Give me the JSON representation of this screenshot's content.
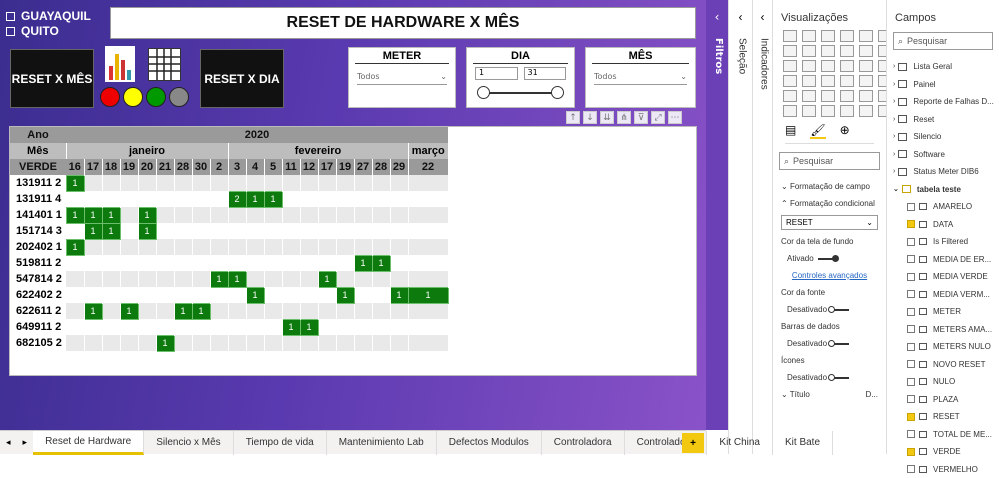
{
  "filters": {
    "guayaquil": "GUAYAQUIL",
    "quito": "QUITO"
  },
  "title": "RESET DE HARDWARE X MÊS",
  "buttons": {
    "reset_mes": "RESET X MÊS",
    "reset_dia": "RESET X DIA"
  },
  "slicers": {
    "meter": {
      "label": "METER",
      "value": "Todos"
    },
    "dia": {
      "label": "DIA",
      "from": "1",
      "to": "31"
    },
    "mes": {
      "label": "MÊS",
      "value": "Todos"
    }
  },
  "matrix": {
    "ano_label": "Ano",
    "year": "2020",
    "mes_label": "Mês",
    "verde_label": "VERDE",
    "months": [
      {
        "name": "janeiro",
        "span": 9
      },
      {
        "name": "fevereiro",
        "span": 12
      },
      {
        "name": "março",
        "span": 1
      }
    ],
    "days": [
      "16",
      "17",
      "18",
      "19",
      "20",
      "21",
      "28",
      "30",
      "2",
      "3",
      "4",
      "5",
      "11",
      "12",
      "17",
      "19",
      "27",
      "28",
      "29",
      "22"
    ],
    "rows": [
      {
        "label": "131911 2",
        "cells": {
          "0": "1"
        }
      },
      {
        "label": "131911 4",
        "cells": {
          "9": "2",
          "10": "1",
          "11": "1"
        }
      },
      {
        "label": "141401 1",
        "cells": {
          "0": "1",
          "1": "1",
          "2": "1",
          "4": "1"
        }
      },
      {
        "label": "151714 3",
        "cells": {
          "1": "1",
          "2": "1",
          "4": "1"
        }
      },
      {
        "label": "202402 1",
        "cells": {
          "0": "1"
        }
      },
      {
        "label": "519811 2",
        "cells": {
          "16": "1",
          "17": "1"
        }
      },
      {
        "label": "547814 2",
        "cells": {
          "8": "1",
          "9": "1",
          "14": "1"
        }
      },
      {
        "label": "622402 2",
        "cells": {
          "10": "1",
          "15": "1",
          "18": "1",
          "19": "1"
        }
      },
      {
        "label": "622611 2",
        "cells": {
          "1": "1",
          "3": "1",
          "6": "1",
          "7": "1"
        }
      },
      {
        "label": "649911 2",
        "cells": {
          "12": "1",
          "13": "1"
        }
      },
      {
        "label": "682105 2",
        "cells": {
          "5": "1"
        }
      }
    ]
  },
  "tabs": [
    "Reset de Hardware",
    "Silencio x Mês",
    "Tiempo de vida",
    "Mantenimiento Lab",
    "Defectos Modulos",
    "Controladora",
    "Controladora",
    "Kit China",
    "Kit Bate"
  ],
  "pane_labels": {
    "filtros": "Filtros",
    "selecao": "Seleção",
    "indicadores": "Indicadores"
  },
  "visualizacoes": {
    "title": "Visualizações",
    "search": "Pesquisar",
    "sections": [
      "Formatação de campo",
      "Formatação condicional"
    ],
    "field_select": "RESET",
    "cor_tela": "Cor da tela de fundo",
    "ativado": "Ativado",
    "controles": "Controles avançados",
    "cor_fonte": "Cor da fonte",
    "desativado": "Desativado",
    "barras": "Barras de dados",
    "icones": "Ícones",
    "titulo": "Título",
    "titulo_d": "D..."
  },
  "campos": {
    "title": "Campos",
    "search": "Pesquisar",
    "tables": [
      "Lista Geral",
      "Painel",
      "Reporte de Falhas D...",
      "Reset",
      "Silencio",
      "Software",
      "Status Meter DIB6"
    ],
    "table_open": "tabela teste",
    "fields": [
      {
        "name": "AMARELO",
        "checked": false
      },
      {
        "name": "DATA",
        "checked": true
      },
      {
        "name": "Is Filtered",
        "checked": false
      },
      {
        "name": "MEDIA DE ER...",
        "checked": false
      },
      {
        "name": "MEDIA VERDE",
        "checked": false
      },
      {
        "name": "MEDIA VERM...",
        "checked": false
      },
      {
        "name": "METER",
        "checked": false
      },
      {
        "name": "METERS AMA...",
        "checked": false
      },
      {
        "name": "METERS NULO",
        "checked": false
      },
      {
        "name": "NOVO RESET",
        "checked": false
      },
      {
        "name": "NULO",
        "checked": false
      },
      {
        "name": "PLAZA",
        "checked": false
      },
      {
        "name": "RESET",
        "checked": true
      },
      {
        "name": "TOTAL DE ME...",
        "checked": false
      },
      {
        "name": "VERDE",
        "checked": true
      },
      {
        "name": "VERMELHO",
        "checked": false
      }
    ]
  },
  "colors": {
    "green": "#0d7a0d",
    "canvas": "#5a3ab0"
  }
}
